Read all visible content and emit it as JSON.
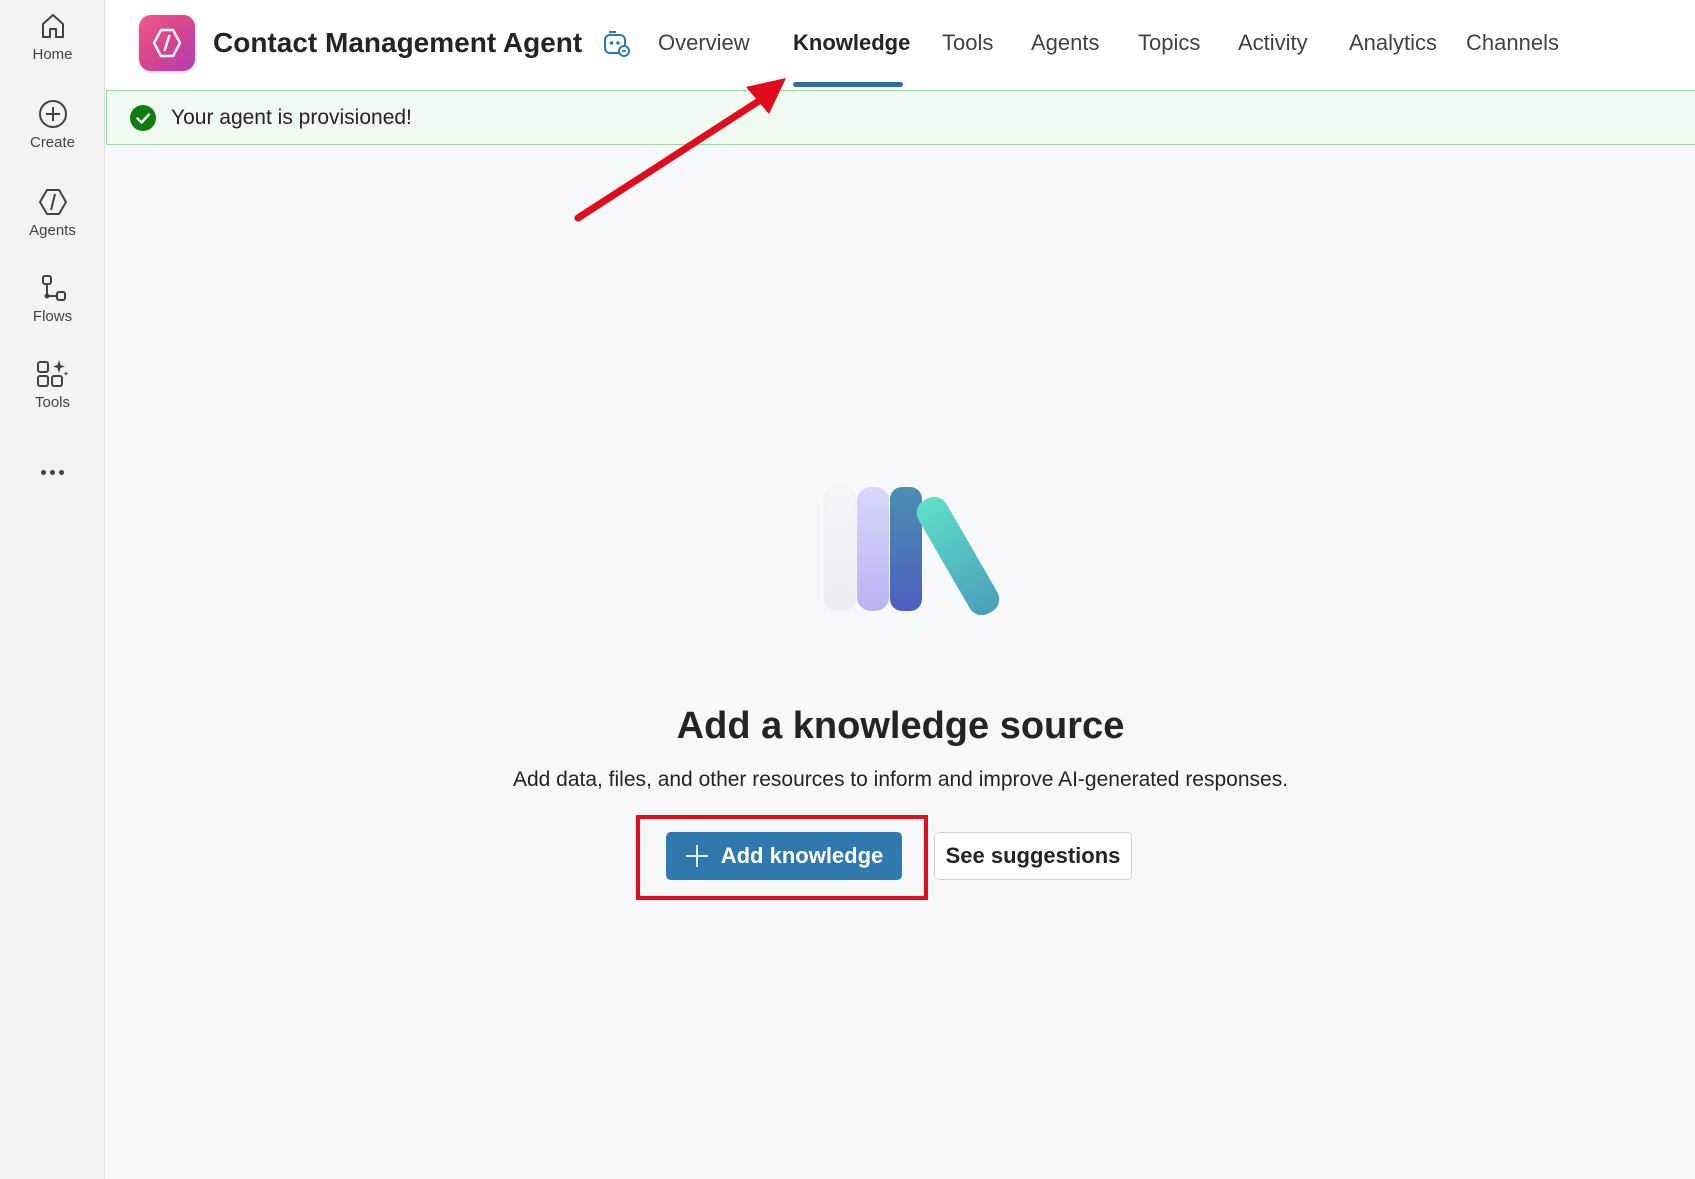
{
  "rail": {
    "items": [
      {
        "label": "Home",
        "icon": "home-icon"
      },
      {
        "label": "Create",
        "icon": "plus-circle-icon"
      },
      {
        "label": "Agents",
        "icon": "agents-icon"
      },
      {
        "label": "Flows",
        "icon": "flows-icon"
      },
      {
        "label": "Tools",
        "icon": "tools-icon"
      }
    ],
    "more_icon": "more-horizontal-icon"
  },
  "header": {
    "title": "Contact Management Agent",
    "tabs": [
      {
        "label": "Overview"
      },
      {
        "label": "Knowledge",
        "active": true
      },
      {
        "label": "Tools"
      },
      {
        "label": "Agents"
      },
      {
        "label": "Topics"
      },
      {
        "label": "Activity"
      },
      {
        "label": "Analytics"
      },
      {
        "label": "Channels"
      }
    ]
  },
  "banner": {
    "text": "Your agent is provisioned!",
    "status_color": "#107c10"
  },
  "empty_state": {
    "heading": "Add a knowledge source",
    "description": "Add data, files, and other resources to inform and improve AI-generated responses.",
    "primary_button": "Add knowledge",
    "secondary_button": "See suggestions"
  },
  "annotations": {
    "color": "#e00b1c",
    "arrow_target": "Knowledge",
    "highlight_target": "Add knowledge"
  },
  "colors": {
    "accent": "#2f79ae",
    "brand_gradient": [
      "#f05a8a",
      "#b13fb4"
    ]
  }
}
